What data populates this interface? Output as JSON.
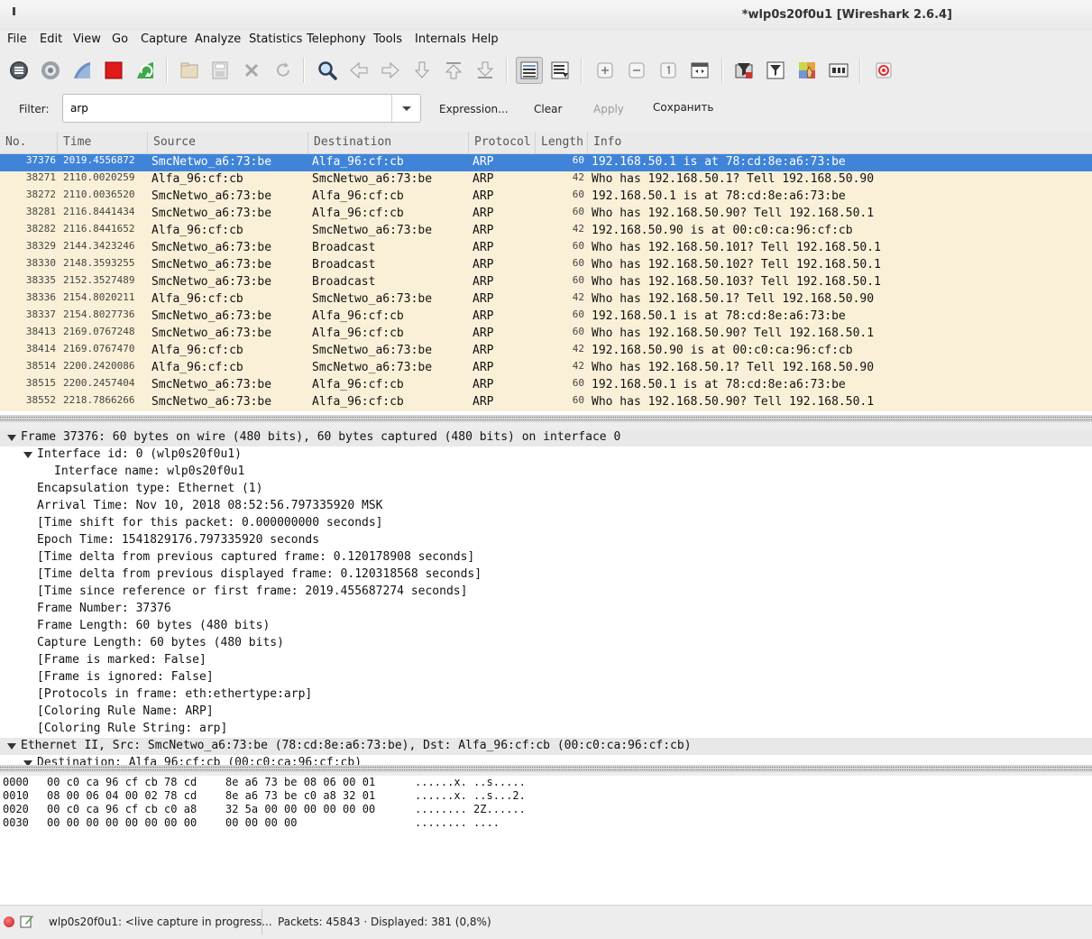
{
  "window": {
    "title": "*wlp0s20f0u1 [Wireshark 2.6.4]"
  },
  "menu": [
    "File",
    "Edit",
    "View",
    "Go",
    "Capture",
    "Analyze",
    "Statistics",
    "Telephony",
    "Tools",
    "Internals",
    "Help"
  ],
  "toolbar": {
    "icons": [
      "interfaces-icon",
      "options-icon",
      "start-capture-icon",
      "stop-capture-icon",
      "restart-capture-icon",
      "open-file-icon",
      "save-file-icon",
      "close-file-icon",
      "reload-file-icon",
      "find-packet-icon",
      "go-back-icon",
      "go-forward-icon",
      "go-to-packet-icon",
      "go-first-icon",
      "go-last-icon",
      "colorize-icon",
      "autoscroll-icon",
      "zoom-in-icon",
      "zoom-out-icon",
      "normal-size-icon",
      "resize-columns-icon",
      "capture-filters-icon",
      "display-filters-icon",
      "coloring-rules-icon",
      "preferences-icon",
      "help-icon"
    ]
  },
  "filter": {
    "label": "Filter:",
    "value": "arp",
    "expression_label": "Expression...",
    "clear_label": "Clear",
    "apply_label": "Apply",
    "save_label": "Сохранить"
  },
  "packet_list": {
    "columns": [
      "No.",
      "Time",
      "Source",
      "Destination",
      "Protocol",
      "Length",
      "Info"
    ],
    "rows": [
      {
        "no": "37376",
        "time": "2019.4556872",
        "src": "SmcNetwo_a6:73:be",
        "dst": "Alfa_96:cf:cb",
        "proto": "ARP",
        "len": "60",
        "info": "192.168.50.1 is at 78:cd:8e:a6:73:be",
        "selected": true
      },
      {
        "no": "38271",
        "time": "2110.0020259",
        "src": "Alfa_96:cf:cb",
        "dst": "SmcNetwo_a6:73:be",
        "proto": "ARP",
        "len": "42",
        "info": "Who has 192.168.50.1? Tell 192.168.50.90"
      },
      {
        "no": "38272",
        "time": "2110.0036520",
        "src": "SmcNetwo_a6:73:be",
        "dst": "Alfa_96:cf:cb",
        "proto": "ARP",
        "len": "60",
        "info": "192.168.50.1 is at 78:cd:8e:a6:73:be"
      },
      {
        "no": "38281",
        "time": "2116.8441434",
        "src": "SmcNetwo_a6:73:be",
        "dst": "Alfa_96:cf:cb",
        "proto": "ARP",
        "len": "60",
        "info": "Who has 192.168.50.90? Tell 192.168.50.1"
      },
      {
        "no": "38282",
        "time": "2116.8441652",
        "src": "Alfa_96:cf:cb",
        "dst": "SmcNetwo_a6:73:be",
        "proto": "ARP",
        "len": "42",
        "info": "192.168.50.90 is at 00:c0:ca:96:cf:cb"
      },
      {
        "no": "38329",
        "time": "2144.3423246",
        "src": "SmcNetwo_a6:73:be",
        "dst": "Broadcast",
        "proto": "ARP",
        "len": "60",
        "info": "Who has 192.168.50.101? Tell 192.168.50.1"
      },
      {
        "no": "38330",
        "time": "2148.3593255",
        "src": "SmcNetwo_a6:73:be",
        "dst": "Broadcast",
        "proto": "ARP",
        "len": "60",
        "info": "Who has 192.168.50.102? Tell 192.168.50.1"
      },
      {
        "no": "38335",
        "time": "2152.3527489",
        "src": "SmcNetwo_a6:73:be",
        "dst": "Broadcast",
        "proto": "ARP",
        "len": "60",
        "info": "Who has 192.168.50.103? Tell 192.168.50.1"
      },
      {
        "no": "38336",
        "time": "2154.8020211",
        "src": "Alfa_96:cf:cb",
        "dst": "SmcNetwo_a6:73:be",
        "proto": "ARP",
        "len": "42",
        "info": "Who has 192.168.50.1? Tell 192.168.50.90"
      },
      {
        "no": "38337",
        "time": "2154.8027736",
        "src": "SmcNetwo_a6:73:be",
        "dst": "Alfa_96:cf:cb",
        "proto": "ARP",
        "len": "60",
        "info": "192.168.50.1 is at 78:cd:8e:a6:73:be"
      },
      {
        "no": "38413",
        "time": "2169.0767248",
        "src": "SmcNetwo_a6:73:be",
        "dst": "Alfa_96:cf:cb",
        "proto": "ARP",
        "len": "60",
        "info": "Who has 192.168.50.90? Tell 192.168.50.1"
      },
      {
        "no": "38414",
        "time": "2169.0767470",
        "src": "Alfa_96:cf:cb",
        "dst": "SmcNetwo_a6:73:be",
        "proto": "ARP",
        "len": "42",
        "info": "192.168.50.90 is at 00:c0:ca:96:cf:cb"
      },
      {
        "no": "38514",
        "time": "2200.2420086",
        "src": "Alfa_96:cf:cb",
        "dst": "SmcNetwo_a6:73:be",
        "proto": "ARP",
        "len": "42",
        "info": "Who has 192.168.50.1? Tell 192.168.50.90"
      },
      {
        "no": "38515",
        "time": "2200.2457404",
        "src": "SmcNetwo_a6:73:be",
        "dst": "Alfa_96:cf:cb",
        "proto": "ARP",
        "len": "60",
        "info": "192.168.50.1 is at 78:cd:8e:a6:73:be"
      },
      {
        "no": "38552",
        "time": "2218.7866266",
        "src": "SmcNetwo_a6:73:be",
        "dst": "Alfa_96:cf:cb",
        "proto": "ARP",
        "len": "60",
        "info": "Who has 192.168.50.90? Tell 192.168.50.1"
      }
    ]
  },
  "details": [
    {
      "text": "Frame 37376: 60 bytes on wire (480 bits), 60 bytes captured (480 bits) on interface 0",
      "level": 0,
      "expanded": true,
      "header": true
    },
    {
      "text": "Interface id: 0 (wlp0s20f0u1)",
      "level": 1,
      "expanded": true
    },
    {
      "text": "Interface name: wlp0s20f0u1",
      "level": 2
    },
    {
      "text": "Encapsulation type: Ethernet (1)",
      "level": 1
    },
    {
      "text": "Arrival Time: Nov 10, 2018 08:52:56.797335920 MSK",
      "level": 1
    },
    {
      "text": "[Time shift for this packet: 0.000000000 seconds]",
      "level": 1
    },
    {
      "text": "Epoch Time: 1541829176.797335920 seconds",
      "level": 1
    },
    {
      "text": "[Time delta from previous captured frame: 0.120178908 seconds]",
      "level": 1
    },
    {
      "text": "[Time delta from previous displayed frame: 0.120318568 seconds]",
      "level": 1
    },
    {
      "text": "[Time since reference or first frame: 2019.455687274 seconds]",
      "level": 1
    },
    {
      "text": "Frame Number: 37376",
      "level": 1
    },
    {
      "text": "Frame Length: 60 bytes (480 bits)",
      "level": 1
    },
    {
      "text": "Capture Length: 60 bytes (480 bits)",
      "level": 1
    },
    {
      "text": "[Frame is marked: False]",
      "level": 1
    },
    {
      "text": "[Frame is ignored: False]",
      "level": 1
    },
    {
      "text": "[Protocols in frame: eth:ethertype:arp]",
      "level": 1
    },
    {
      "text": "[Coloring Rule Name: ARP]",
      "level": 1
    },
    {
      "text": "[Coloring Rule String: arp]",
      "level": 1
    },
    {
      "text": "Ethernet II, Src: SmcNetwo_a6:73:be (78:cd:8e:a6:73:be), Dst: Alfa_96:cf:cb (00:c0:ca:96:cf:cb)",
      "level": 0,
      "expanded": true,
      "header": true
    },
    {
      "text": "Destination: Alfa_96:cf:cb (00:c0:ca:96:cf:cb)",
      "level": 1,
      "expanded": true
    }
  ],
  "hex": [
    {
      "offset": "0000",
      "bytes1": "00 c0 ca 96 cf cb 78 cd",
      "bytes2": "8e a6 73 be 08 06 00 01",
      "ascii": "......x. ..s....."
    },
    {
      "offset": "0010",
      "bytes1": "08 00 06 04 00 02 78 cd",
      "bytes2": "8e a6 73 be c0 a8 32 01",
      "ascii": "......x. ..s...2."
    },
    {
      "offset": "0020",
      "bytes1": "00 c0 ca 96 cf cb c0 a8",
      "bytes2": "32 5a 00 00 00 00 00 00",
      "ascii": "........ 2Z......"
    },
    {
      "offset": "0030",
      "bytes1": "00 00 00 00 00 00 00 00",
      "bytes2": "00 00 00 00",
      "ascii": "........ ...."
    }
  ],
  "status": {
    "capture_text": "wlp0s20f0u1: <live capture in progress...",
    "packets_text": "Packets: 45843 · Displayed: 381 (0,8%)"
  },
  "colors": {
    "selected_row": "#3f84d8",
    "arp_row": "#faf0d7"
  }
}
